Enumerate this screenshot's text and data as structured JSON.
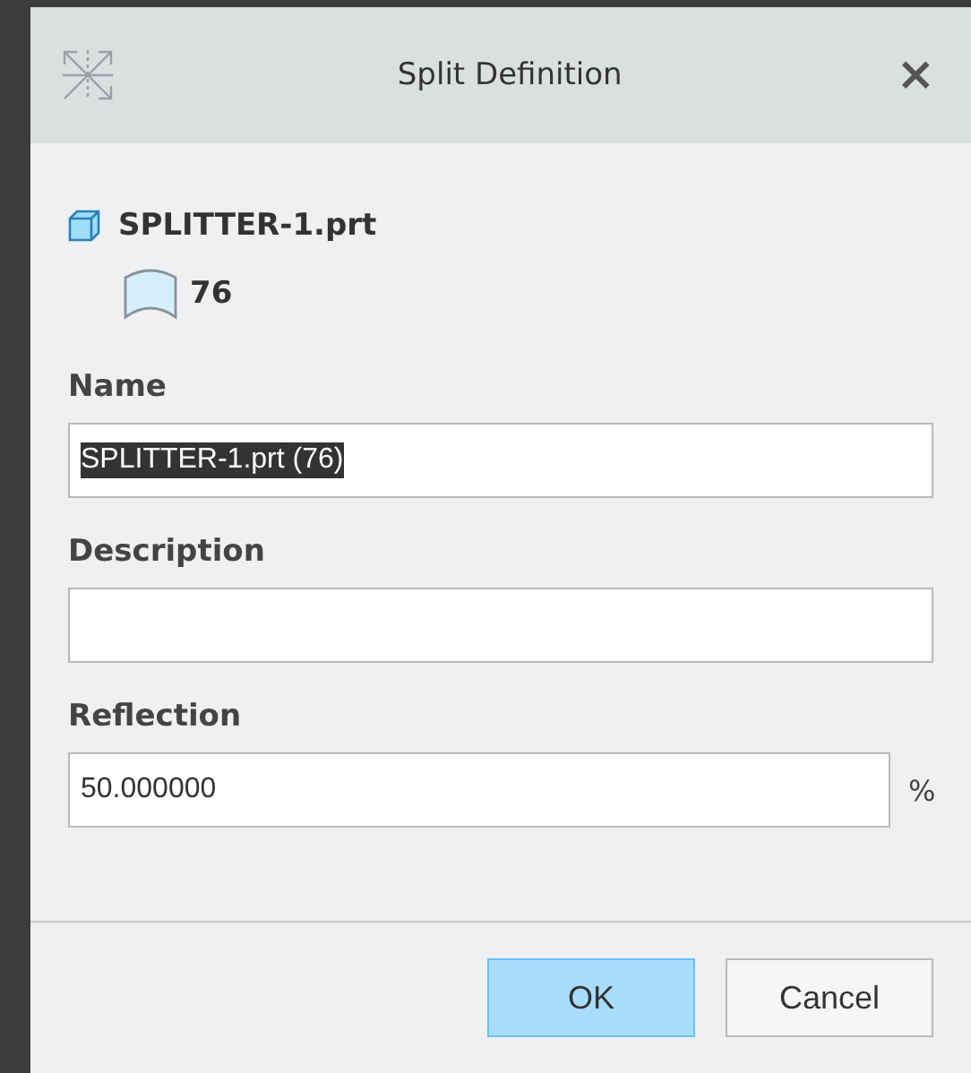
{
  "window": {
    "title": "Split Definition",
    "close": "×"
  },
  "tree": {
    "part": "SPLITTER-1.prt",
    "children": [
      {
        "label": "76"
      }
    ]
  },
  "fields": [
    {
      "label": "Name",
      "value": "SPLITTER-1.prt (76)",
      "text_selected": true
    },
    {
      "label": "Description"
    },
    {
      "label": "Reflection",
      "value": "50.000000",
      "text_selected": false,
      "unit": "%"
    }
  ],
  "buttons": [
    {
      "label": "OK",
      "default": true
    },
    {
      "label": "Cancel",
      "default": false
    }
  ]
}
